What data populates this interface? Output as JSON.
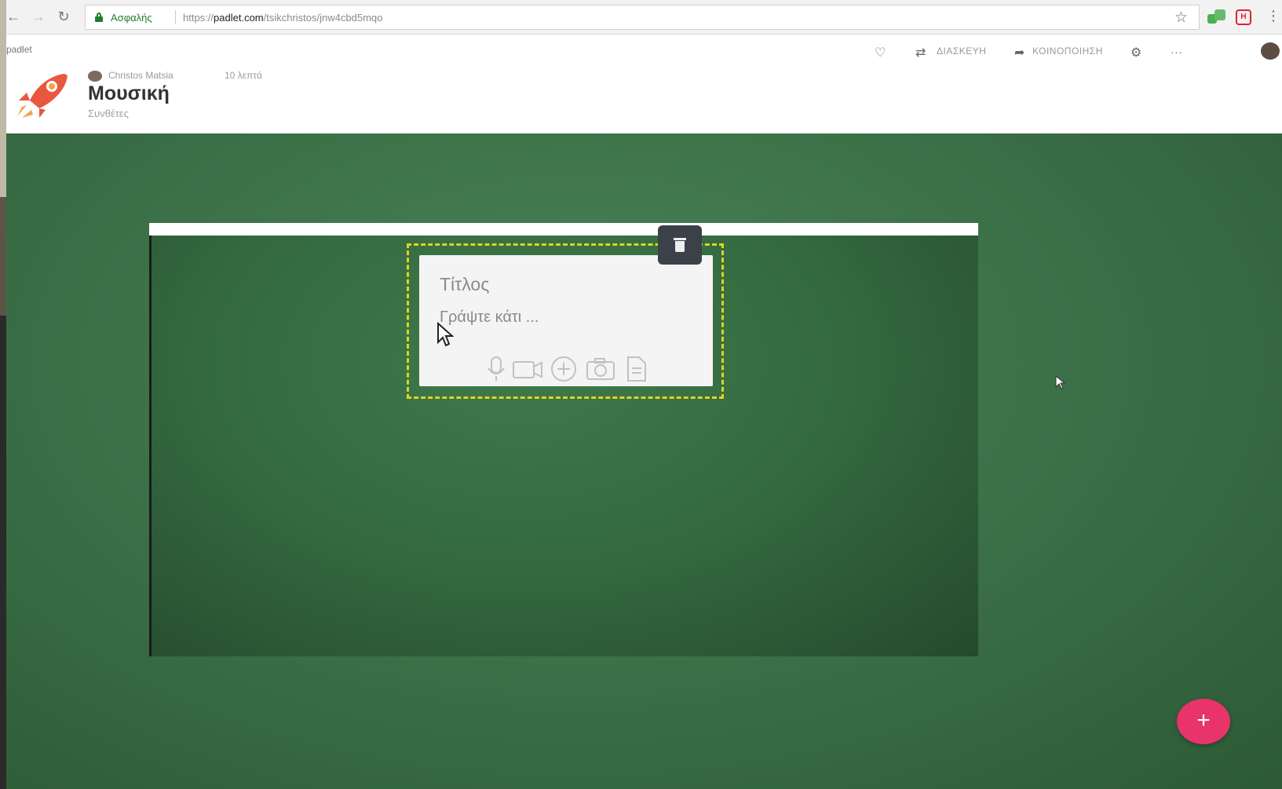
{
  "browser": {
    "secure_label": "Ασφαλής",
    "url_prefix": "https://",
    "url_domain": "padlet.com",
    "url_path": "/tsikchristos/jnw4cbd5mqo"
  },
  "padlet": {
    "brand": "padlet",
    "author": "Christos Matsia",
    "time": "10 λεπτά",
    "title": "Μουσική",
    "subtitle": "Συνθέτες",
    "actions": {
      "remake": "ΔΙΑΣΚΕΥΗ",
      "share": "ΚΟΙΝΟΠΟΙΗΣΗ",
      "more": "···"
    }
  },
  "post": {
    "title_placeholder": "Τίτλος",
    "body_placeholder": "Γράψτε κάτι ..."
  },
  "fab": {
    "label": "+"
  },
  "colors": {
    "board_green": "#3d7249",
    "selection_yellow": "#e0d322",
    "fab_pink": "#e8336b",
    "trash_bg": "#3c4048"
  }
}
